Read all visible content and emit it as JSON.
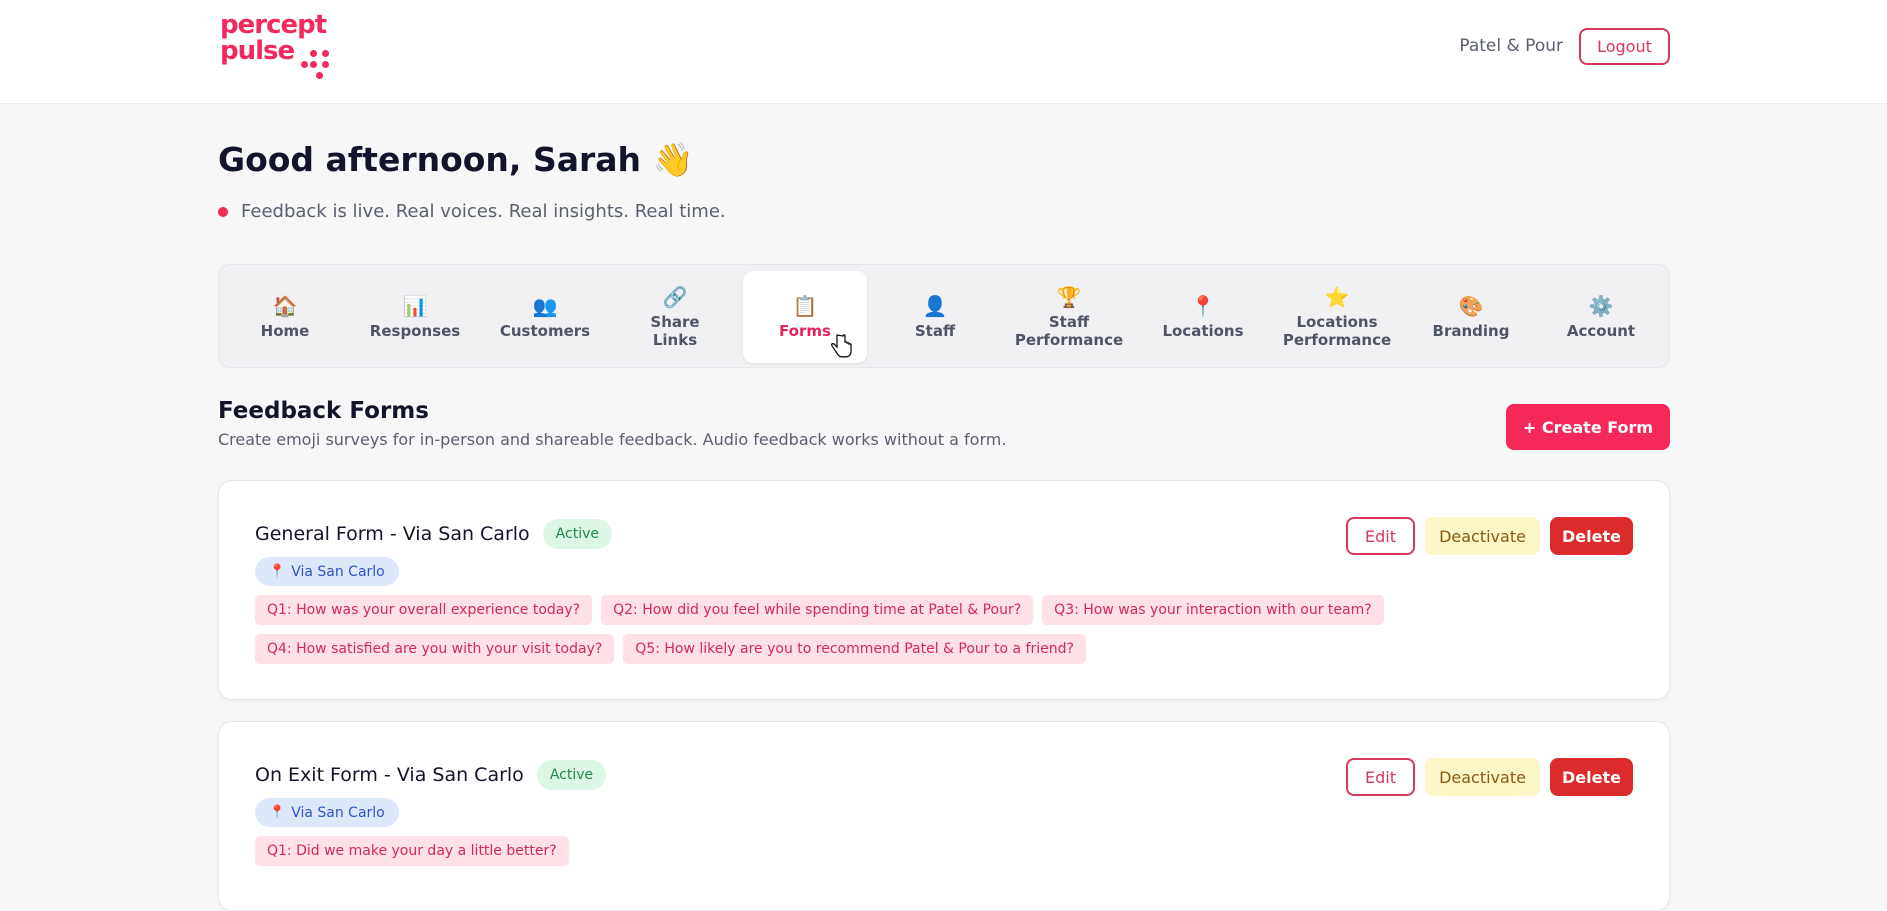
{
  "brand": {
    "logo_line1": "percept",
    "logo_line2": "pulse",
    "accent": "#f2295b"
  },
  "header": {
    "account_name": "Patel & Pour",
    "logout_label": "Logout"
  },
  "greeting": {
    "text": "Good afternoon, Sarah",
    "emoji": "👋",
    "status": "Feedback is live. Real voices. Real insights. Real time."
  },
  "nav": {
    "items": [
      {
        "label": "Home",
        "icon": "🏠",
        "icon_name": "home-icon"
      },
      {
        "label": "Responses",
        "icon": "📊",
        "icon_name": "bar-chart-icon"
      },
      {
        "label": "Customers",
        "icon": "👥",
        "icon_name": "users-icon"
      },
      {
        "label": "Share\nLinks",
        "icon": "🔗",
        "icon_name": "link-icon"
      },
      {
        "label": "Forms",
        "icon": "📋",
        "icon_name": "clipboard-icon",
        "active": true
      },
      {
        "label": "Staff",
        "icon": "👤",
        "icon_name": "user-icon"
      },
      {
        "label": "Staff\nPerformance",
        "icon": "🏆",
        "icon_name": "trophy-icon"
      },
      {
        "label": "Locations",
        "icon": "📍",
        "icon_name": "pin-icon"
      },
      {
        "label": "Locations\nPerformance",
        "icon": "⭐",
        "icon_name": "star-icon"
      },
      {
        "label": "Branding",
        "icon": "🎨",
        "icon_name": "palette-icon"
      },
      {
        "label": "Account",
        "icon": "⚙️",
        "icon_name": "gear-icon"
      }
    ]
  },
  "section": {
    "title": "Feedback Forms",
    "description": "Create emoji surveys for in-person and shareable feedback. Audio feedback works without a form.",
    "create_label": "+ Create Form"
  },
  "forms": [
    {
      "title": "General Form - Via San Carlo",
      "status": "Active",
      "location": "Via San Carlo",
      "questions": [
        [
          "Q1: How was your overall experience today?",
          "Q2: How did you feel while spending time at Patel & Pour?",
          "Q3: How was your interaction with our team?"
        ],
        [
          "Q4: How satisfied are you with your visit today?",
          "Q5: How likely are you to recommend Patel & Pour to a friend?"
        ]
      ],
      "edit_label": "Edit",
      "deactivate_label": "Deactivate",
      "delete_label": "Delete"
    },
    {
      "title": "On Exit Form - Via San Carlo",
      "status": "Active",
      "location": "Via San Carlo",
      "questions": [
        [
          "Q1: Did we make your day a little better?"
        ]
      ],
      "edit_label": "Edit",
      "deactivate_label": "Deactivate",
      "delete_label": "Delete"
    }
  ]
}
